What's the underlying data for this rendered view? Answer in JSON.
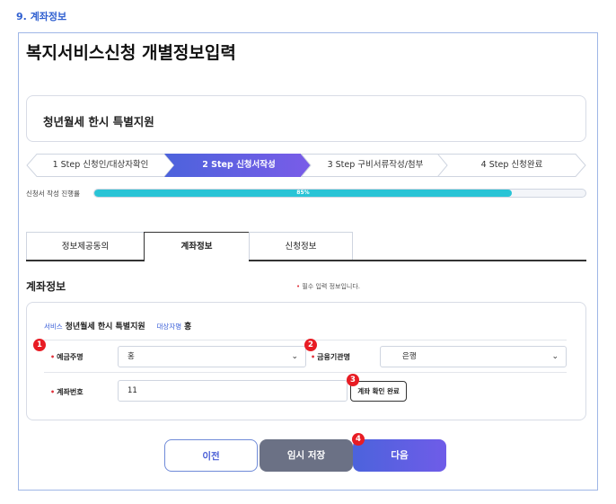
{
  "section": {
    "number": "9.",
    "label": "계좌정보"
  },
  "page": {
    "title": "복지서비스신청 개별정보입력"
  },
  "service": {
    "name": "청년월세 한시 특별지원"
  },
  "steps": [
    {
      "label": "1 Step 신청인/대상자확인",
      "active": false
    },
    {
      "label": "2 Step 신청서작성",
      "active": true
    },
    {
      "label": "3 Step 구비서류작성/첨부",
      "active": false
    },
    {
      "label": "4 Step 신청완료",
      "active": false
    }
  ],
  "progress": {
    "label": "신청서 작성 진행률",
    "percent": 85,
    "text": "85%"
  },
  "tabs": [
    {
      "label": "정보제공동의",
      "active": false
    },
    {
      "label": "계좌정보",
      "active": true
    },
    {
      "label": "신청정보",
      "active": false
    }
  ],
  "form": {
    "title": "계좌정보",
    "required_note": "필수 입력 정보입니다.",
    "service_label": "서비스",
    "service_value": "청년월세 한시 특별지원",
    "target_label": "대상자명",
    "target_value": "홍",
    "account_holder": {
      "label": "예금주명",
      "value": "홍"
    },
    "bank": {
      "label": "금융기관명",
      "value": "은행"
    },
    "account_number": {
      "label": "계좌번호",
      "value": "11"
    },
    "confirm_button": "계좌 확인 완료"
  },
  "buttons": {
    "prev": "이전",
    "save": "임시 저장",
    "next": "다음"
  },
  "markers": [
    "1",
    "2",
    "3",
    "4"
  ],
  "colors": {
    "accent": "#5b63e0",
    "progress": "#29c4d6",
    "marker": "#e81c24",
    "required": "#e0303a"
  }
}
